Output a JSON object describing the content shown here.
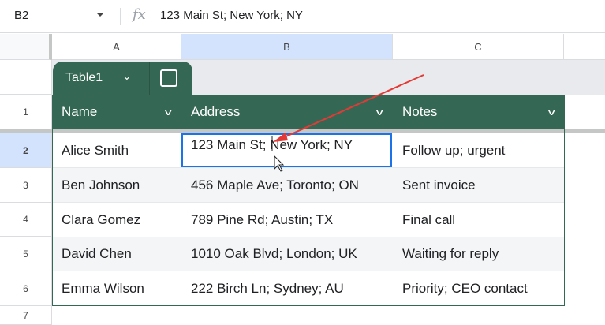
{
  "formula_bar": {
    "cell_ref": "B2",
    "fx": "fx",
    "value": "123 Main St; New York; NY"
  },
  "columns": [
    "A",
    "B",
    "C"
  ],
  "rows": [
    "1",
    "2",
    "3",
    "4",
    "5",
    "6",
    "7"
  ],
  "table": {
    "name": "Table1",
    "headers": [
      "Name",
      "Address",
      "Notes"
    ],
    "data": [
      [
        "Alice Smith",
        "123 Main St; New York; NY",
        "Follow up; urgent"
      ],
      [
        "Ben Johnson",
        "456 Maple Ave; Toronto; ON",
        "Sent invoice"
      ],
      [
        "Clara Gomez",
        "789 Pine Rd; Austin; TX",
        "Final call"
      ],
      [
        "David Chen",
        "1010 Oak Blvd; London; UK",
        "Waiting for reply"
      ],
      [
        "Emma Wilson",
        "222 Birch Ln; Sydney; AU",
        "Priority; CEO contact"
      ]
    ]
  },
  "colors": {
    "table_green": "#356854",
    "selection": "#1a73e8",
    "annotation_arrow": "#e53935"
  }
}
